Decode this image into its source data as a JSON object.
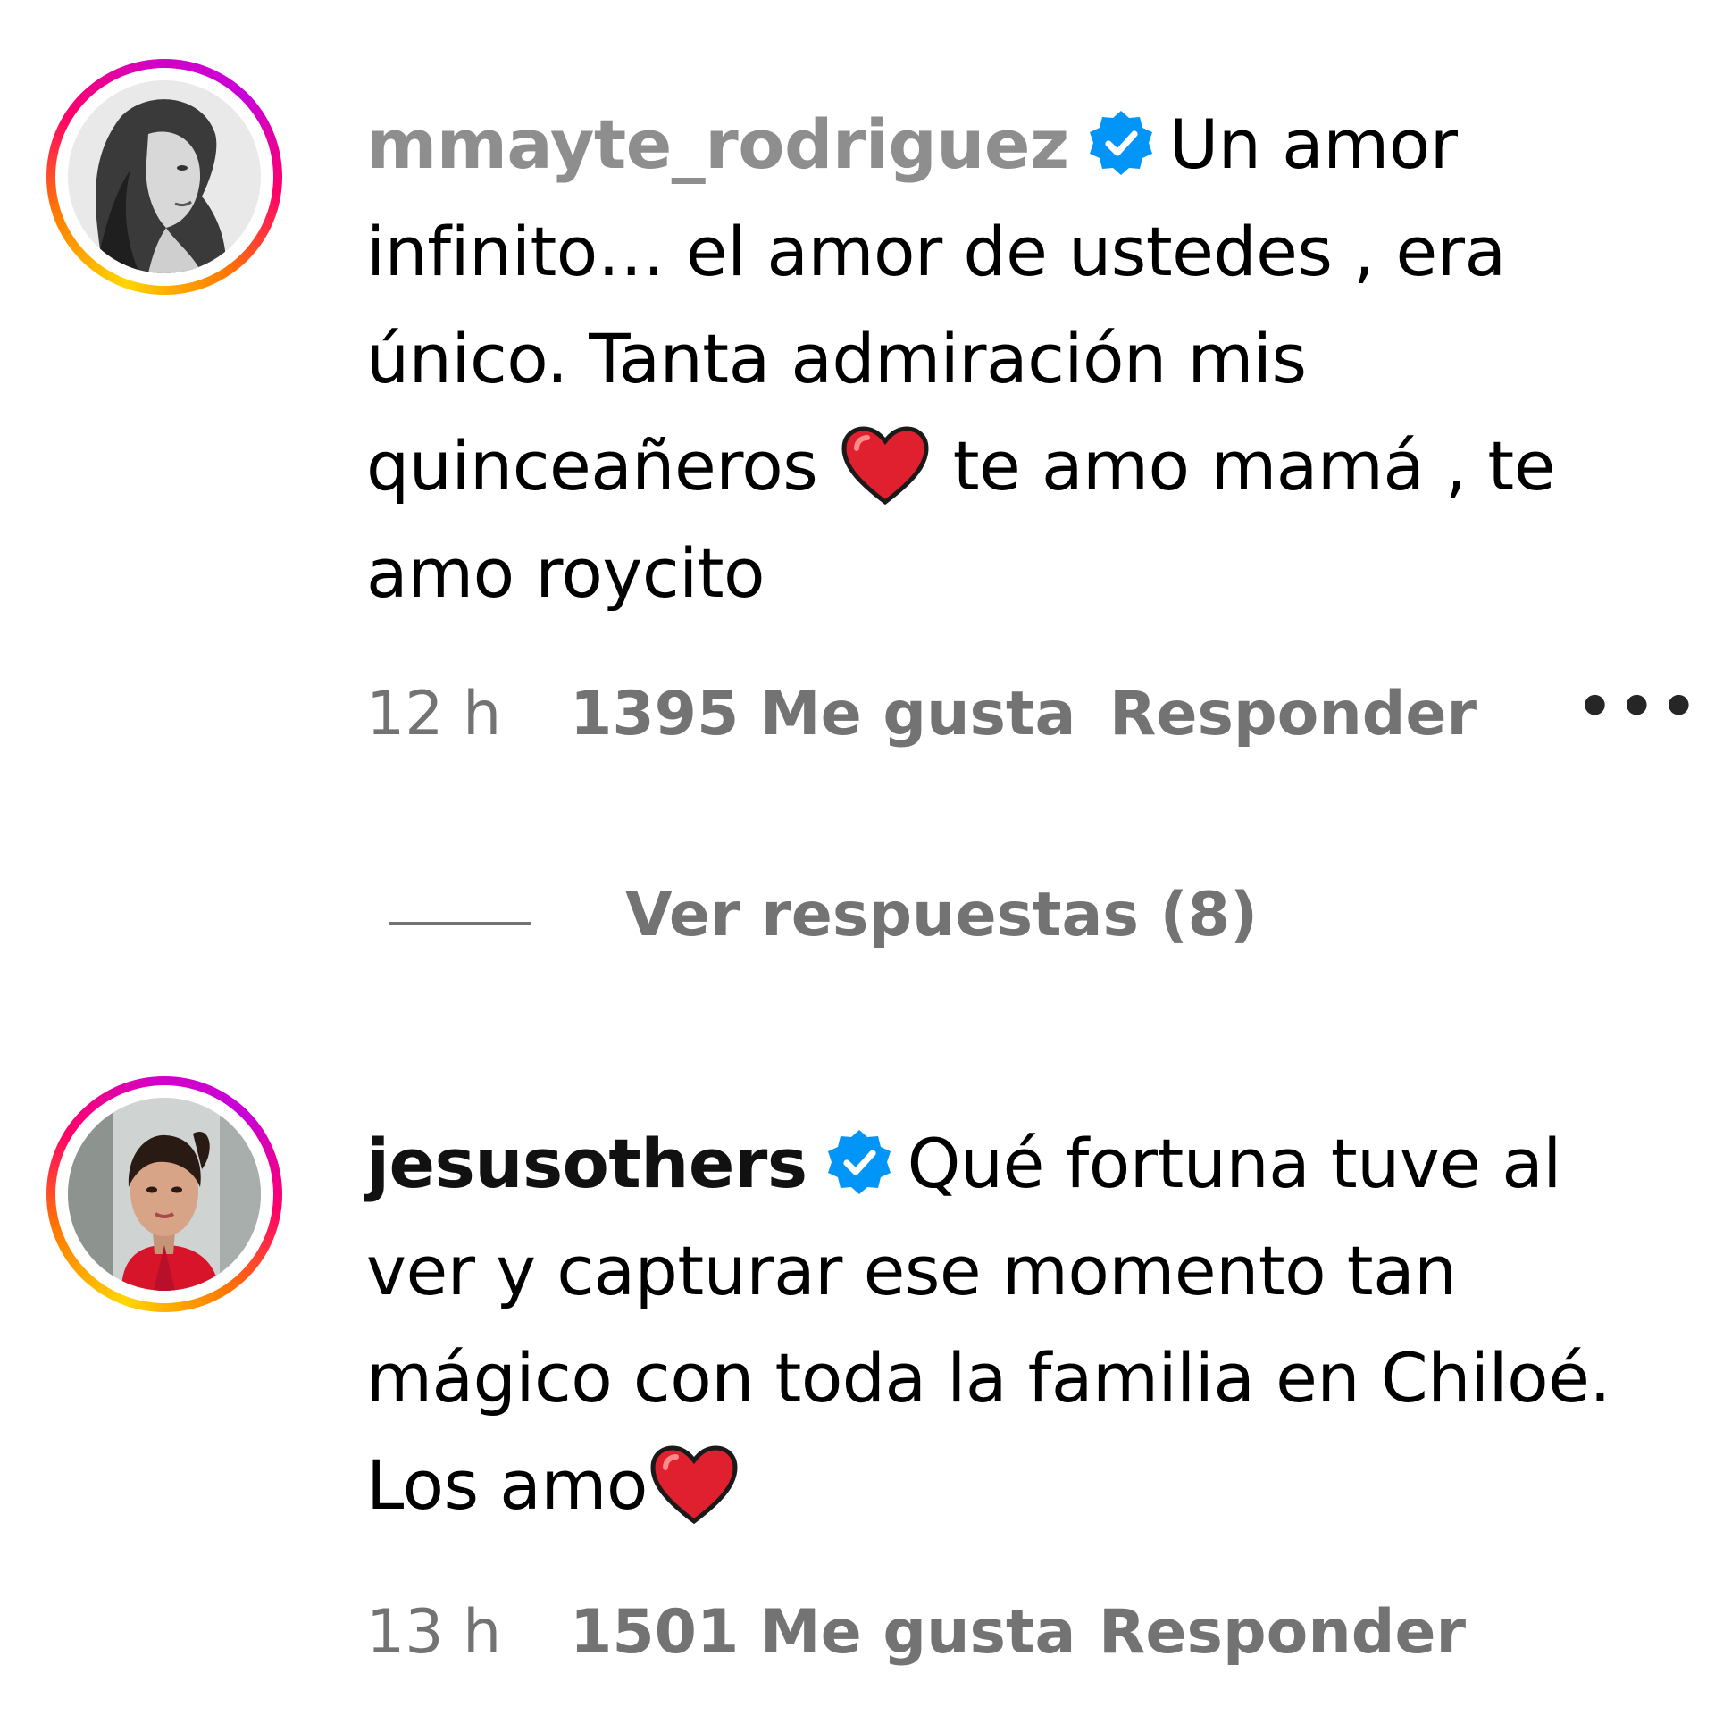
{
  "comments": [
    {
      "username": "mmayte_rodriguez",
      "text_before_heart": "Un amor infinito… el amor de ustedes , era único. Tanta admiración mis quinceañeros",
      "text_after_heart": " te amo mamá , te amo roycito",
      "time": "12 h",
      "likes": "1395 Me gusta",
      "reply": "Responder",
      "more": "•••"
    },
    {
      "username": "jesusothers",
      "text_before_heart": "Qué fortuna tuve al ver y capturar ese momento tan mágico con toda la familia en Chiloé. Los amo",
      "text_after_heart": "",
      "time": "13 h",
      "likes": "1501 Me gusta",
      "reply": "Responder"
    }
  ],
  "view_replies": "Ver respuestas (8)",
  "icons": {
    "verified": "verified-badge-icon",
    "heart": "red-heart-emoji",
    "more": "more-options-icon"
  },
  "colors": {
    "verified": "#0095f6",
    "secondary_text": "#737373",
    "username_first": "#8e8e8e",
    "heart": "#e0202e"
  }
}
